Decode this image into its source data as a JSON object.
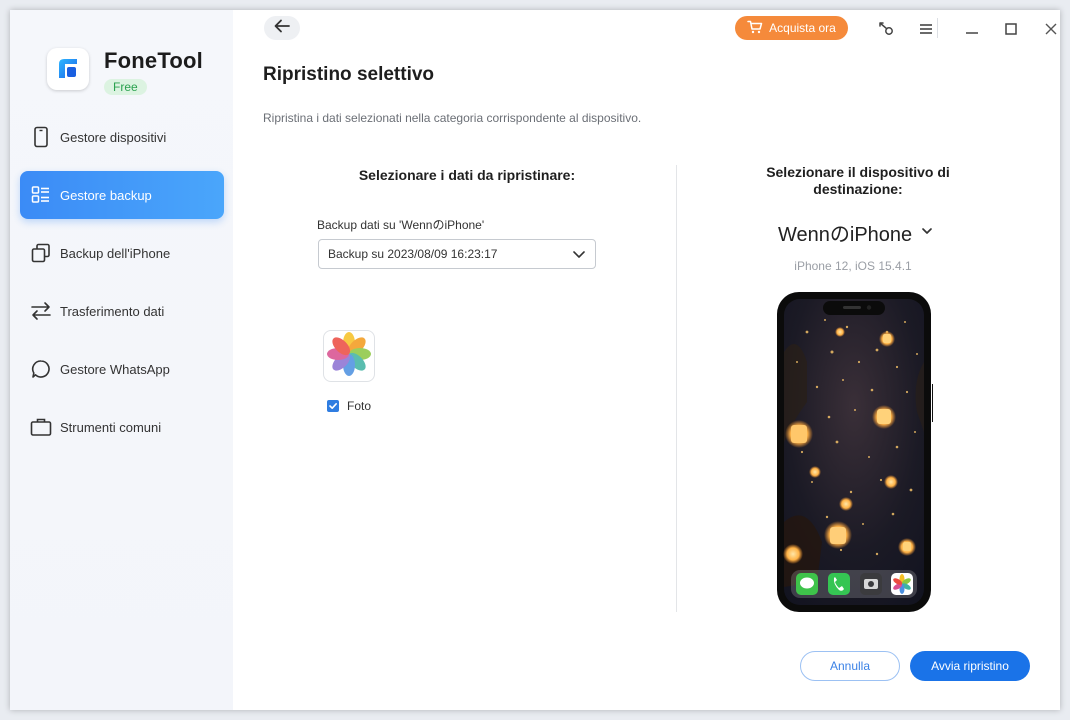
{
  "app": {
    "name": "FoneTool",
    "edition": "Free"
  },
  "sidebar": {
    "items": [
      {
        "label": "Gestore dispositivi",
        "icon": "phone-icon",
        "active": false
      },
      {
        "label": "Gestore backup",
        "icon": "list-icon",
        "active": true
      },
      {
        "label": "Backup dell'iPhone",
        "icon": "copy-icon",
        "active": false
      },
      {
        "label": "Trasferimento dati",
        "icon": "transfer-arrows-icon",
        "active": false
      },
      {
        "label": "Gestore WhatsApp",
        "icon": "chat-bubble-icon",
        "active": false
      },
      {
        "label": "Strumenti comuni",
        "icon": "briefcase-icon",
        "active": false
      }
    ]
  },
  "topbar": {
    "buy_label": "Acquista ora"
  },
  "page": {
    "title": "Ripristino selettivo",
    "description": "Ripristina i dati selezionati nella categoria corrispondente al dispositivo."
  },
  "left_panel": {
    "heading": "Selezionare i dati da ripristinare:",
    "backup_label": "Backup dati su 'WennのiPhone'",
    "backup_selected": "Backup su 2023/08/09 16:23:17",
    "category": {
      "label": "Foto",
      "checked": true
    }
  },
  "right_panel": {
    "heading": "Selezionare il dispositivo di destinazione:",
    "device_name": "WennのiPhone",
    "device_model": "iPhone 12, iOS 15.4.1"
  },
  "actions": {
    "cancel_label": "Annulla",
    "start_label": "Avvia ripristino"
  },
  "colors": {
    "accent": "#1a73e8",
    "sidebar_active": "#3b8bf6",
    "buy": "#f58a3b",
    "free_badge": "#2aa14e"
  }
}
